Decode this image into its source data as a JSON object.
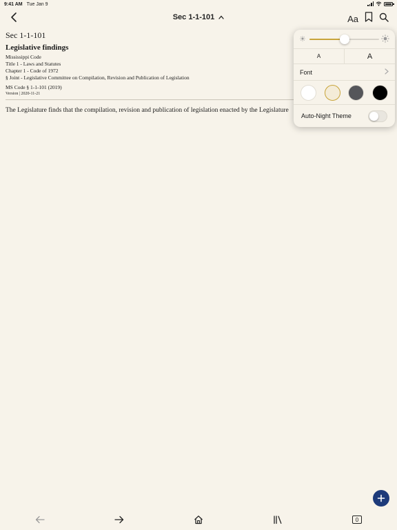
{
  "status": {
    "time": "9:41 AM",
    "date": "Tue Jan 9"
  },
  "nav": {
    "title": "Sec 1-1-101",
    "aa_label": "Aa"
  },
  "document": {
    "section_id": "Sec 1-1-101",
    "title": "Legislative findings",
    "meta": [
      "Mississippi Code",
      "Title 1 - Laws and Statutes",
      "Chapter 1 - Code of 1972",
      "§ Joint - Legislative Committee on Compilation, Revision and Publication of Legislation"
    ],
    "ms_code": "MS Code § 1-1-101 (2019)",
    "version": "Version | 2020-11-21",
    "body": "The Legislature finds that the compilation, revision and publication of legislation enacted by the Legislature"
  },
  "popover": {
    "brightness": 0.5,
    "size_small_label": "A",
    "size_large_label": "A",
    "font_label": "Font",
    "themes": [
      {
        "name": "white",
        "color": "#ffffff",
        "selected": false
      },
      {
        "name": "sepia",
        "color": "#f4ecd8",
        "selected": true
      },
      {
        "name": "gray",
        "color": "#55565a",
        "selected": false
      },
      {
        "name": "black",
        "color": "#000000",
        "selected": false
      }
    ],
    "night_label": "Auto-Night Theme",
    "night_on": false,
    "accent": "#c8a43a"
  },
  "toolbar": {
    "tab_count": "0"
  },
  "fab_color": "#1d3a7a"
}
